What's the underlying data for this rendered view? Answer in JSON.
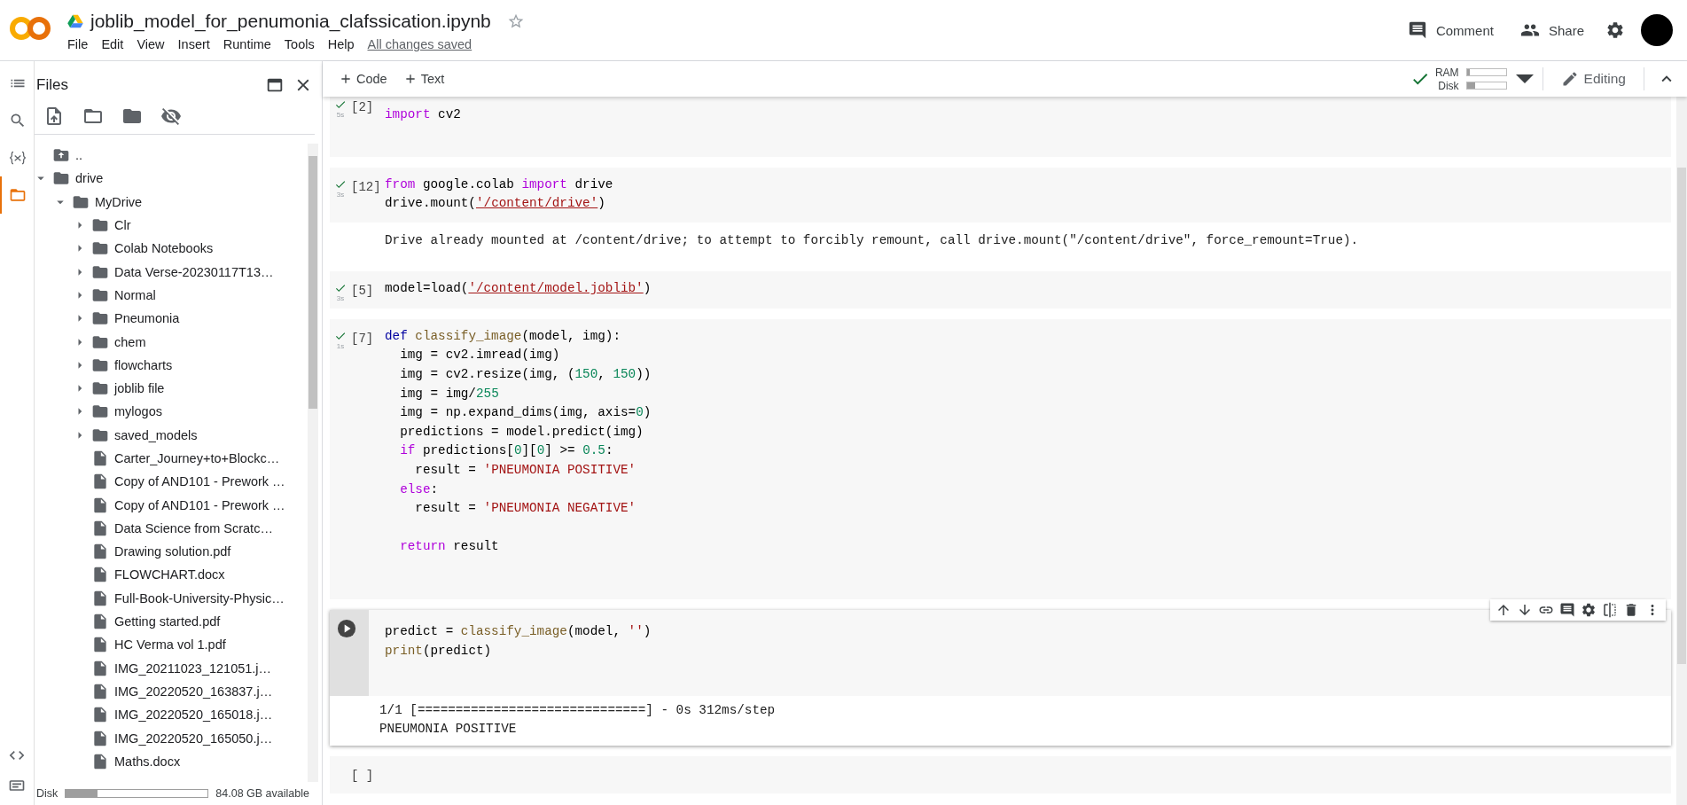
{
  "header": {
    "title": "joblib_model_for_penumonia_clafssication.ipynb",
    "menu": [
      "File",
      "Edit",
      "View",
      "Insert",
      "Runtime",
      "Tools",
      "Help"
    ],
    "save_status": "All changes saved",
    "actions": [
      "Comment",
      "Share"
    ]
  },
  "toolbar": {
    "add": [
      "Code",
      "Text"
    ],
    "connected": true,
    "meters": [
      {
        "label": "RAM",
        "level": 0.08
      },
      {
        "label": "Disk",
        "level": 0.22
      }
    ],
    "mode": "Editing"
  },
  "rail": [
    {
      "kind": "toc",
      "selected": false
    },
    {
      "kind": "search",
      "selected": false
    },
    {
      "kind": "variables",
      "selected": false
    },
    {
      "kind": "files",
      "selected": true
    }
  ],
  "sidebar": {
    "title": "Files",
    "tree": [
      {
        "name": "..",
        "kind": "up"
      },
      {
        "name": "drive",
        "kind": "folder",
        "expanded": true,
        "children": [
          {
            "name": "MyDrive",
            "kind": "folder",
            "expanded": true,
            "children": [
              {
                "name": "Clr",
                "kind": "folder",
                "expanded": false
              },
              {
                "name": "Colab Notebooks",
                "kind": "folder",
                "expanded": false
              },
              {
                "name": "Data Verse-20230117T13…",
                "kind": "folder",
                "expanded": false
              },
              {
                "name": "Normal",
                "kind": "folder",
                "expanded": false
              },
              {
                "name": "Pneumonia",
                "kind": "folder",
                "expanded": false
              },
              {
                "name": "chem",
                "kind": "folder",
                "expanded": false
              },
              {
                "name": "flowcharts",
                "kind": "folder",
                "expanded": false
              },
              {
                "name": "joblib file",
                "kind": "folder",
                "expanded": false
              },
              {
                "name": "mylogos",
                "kind": "folder",
                "expanded": false
              },
              {
                "name": "saved_models",
                "kind": "folder",
                "expanded": false
              },
              {
                "name": "Carter_Journey+to+Blockc…",
                "kind": "file"
              },
              {
                "name": "Copy of AND101 - Prework …",
                "kind": "file"
              },
              {
                "name": "Copy of AND101 - Prework …",
                "kind": "file"
              },
              {
                "name": "Data Science from Scratc…",
                "kind": "file"
              },
              {
                "name": "Drawing solution.pdf",
                "kind": "file"
              },
              {
                "name": "FLOWCHART.docx",
                "kind": "file"
              },
              {
                "name": "Full-Book-University-Physic…",
                "kind": "file"
              },
              {
                "name": "Getting started.pdf",
                "kind": "file"
              },
              {
                "name": "HC Verma vol 1.pdf",
                "kind": "file"
              },
              {
                "name": "IMG_20211023_121051.j…",
                "kind": "file"
              },
              {
                "name": "IMG_20220520_163837.j…",
                "kind": "file"
              },
              {
                "name": "IMG_20220520_165018.j…",
                "kind": "file"
              },
              {
                "name": "IMG_20220520_165050.j…",
                "kind": "file"
              },
              {
                "name": "Maths.docx",
                "kind": "file"
              }
            ]
          }
        ]
      }
    ],
    "disk": {
      "label": "Disk",
      "level": 0.22,
      "free": "84.08 GB available"
    }
  },
  "cells": [
    {
      "count": "[2]",
      "done": true,
      "duration": "5s",
      "selected": false,
      "lines": [
        {
          "tokens": [
            {
              "t": "import",
              "kind": "kw"
            },
            {
              "t": " cv2",
              "kind": "plain"
            }
          ]
        }
      ]
    },
    {
      "count": "[12]",
      "done": true,
      "duration": "3s",
      "selected": false,
      "lines": [
        {
          "tokens": [
            {
              "t": "from",
              "kind": "kw"
            },
            {
              "t": " google.colab ",
              "kind": "plain"
            },
            {
              "t": "import",
              "kind": "kw"
            },
            {
              "t": " drive",
              "kind": "plain"
            }
          ]
        },
        {
          "tokens": [
            {
              "t": "drive.mount(",
              "kind": "plain"
            },
            {
              "t": "'/content/drive'",
              "kind": "path"
            },
            {
              "t": ")",
              "kind": "plain"
            }
          ]
        }
      ],
      "output": [
        "Drive already mounted at /content/drive; to attempt to forcibly remount, call drive.mount(\"/content/drive\", force_remount=True)."
      ]
    },
    {
      "count": "[5]",
      "done": true,
      "duration": "3s",
      "selected": false,
      "lines": [
        {
          "tokens": [
            {
              "t": "model=load(",
              "kind": "plain"
            },
            {
              "t": "'/content/model.joblib'",
              "kind": "path"
            },
            {
              "t": ")",
              "kind": "plain"
            }
          ]
        }
      ]
    },
    {
      "count": "[7]",
      "done": true,
      "duration": "1s",
      "selected": false,
      "lines": [
        {
          "tokens": [
            {
              "t": "def",
              "kind": "def"
            },
            {
              "t": " classify_image",
              "kind": "fn"
            },
            {
              "t": "(model, img):",
              "kind": "plain"
            }
          ]
        },
        {
          "tokens": [
            {
              "t": "  img = cv2.imread(img)",
              "kind": "plain"
            }
          ]
        },
        {
          "tokens": [
            {
              "t": "  img = cv2.resize(img, (",
              "kind": "plain"
            },
            {
              "t": "150",
              "kind": "num"
            },
            {
              "t": ", ",
              "kind": "plain"
            },
            {
              "t": "150",
              "kind": "num"
            },
            {
              "t": "))",
              "kind": "plain"
            }
          ]
        },
        {
          "tokens": [
            {
              "t": "  img = img/",
              "kind": "plain"
            },
            {
              "t": "255",
              "kind": "num"
            }
          ]
        },
        {
          "tokens": [
            {
              "t": "  img = np.expand_dims(img, axis=",
              "kind": "plain"
            },
            {
              "t": "0",
              "kind": "num"
            },
            {
              "t": ")",
              "kind": "plain"
            }
          ]
        },
        {
          "tokens": [
            {
              "t": "  predictions = model.predict(img)",
              "kind": "plain"
            }
          ]
        },
        {
          "tokens": [
            {
              "t": "  if",
              "kind": "kw"
            },
            {
              "t": " predictions[",
              "kind": "plain"
            },
            {
              "t": "0",
              "kind": "num"
            },
            {
              "t": "][",
              "kind": "plain"
            },
            {
              "t": "0",
              "kind": "num"
            },
            {
              "t": "] >= ",
              "kind": "plain"
            },
            {
              "t": "0.5",
              "kind": "num"
            },
            {
              "t": ":",
              "kind": "plain"
            }
          ]
        },
        {
          "tokens": [
            {
              "t": "    result = ",
              "kind": "plain"
            },
            {
              "t": "'PNEUMONIA POSITIVE'",
              "kind": "str"
            }
          ]
        },
        {
          "tokens": [
            {
              "t": "  else",
              "kind": "kw"
            },
            {
              "t": ":",
              "kind": "plain"
            }
          ]
        },
        {
          "tokens": [
            {
              "t": "    result = ",
              "kind": "plain"
            },
            {
              "t": "'PNEUMONIA NEGATIVE'",
              "kind": "str"
            }
          ]
        },
        {
          "blank_before": true,
          "tokens": [
            {
              "t": "  return",
              "kind": "kw"
            },
            {
              "t": " result",
              "kind": "plain"
            }
          ]
        }
      ]
    },
    {
      "selected": true,
      "lines": [
        {
          "tokens": [
            {
              "t": "predict = ",
              "kind": "plain"
            },
            {
              "t": "classify_image",
              "kind": "fn"
            },
            {
              "t": "(model, ",
              "kind": "plain"
            },
            {
              "t": "''",
              "kind": "str"
            },
            {
              "t": ")",
              "kind": "plain"
            }
          ]
        },
        {
          "tokens": [
            {
              "t": "print",
              "kind": "fn"
            },
            {
              "t": "(predict)",
              "kind": "plain"
            }
          ]
        }
      ],
      "output": [
        "1/1 [==============================] - 0s 312ms/step",
        "PNEUMONIA POSITIVE"
      ]
    },
    {
      "count": "[ ]",
      "selected": false
    }
  ]
}
